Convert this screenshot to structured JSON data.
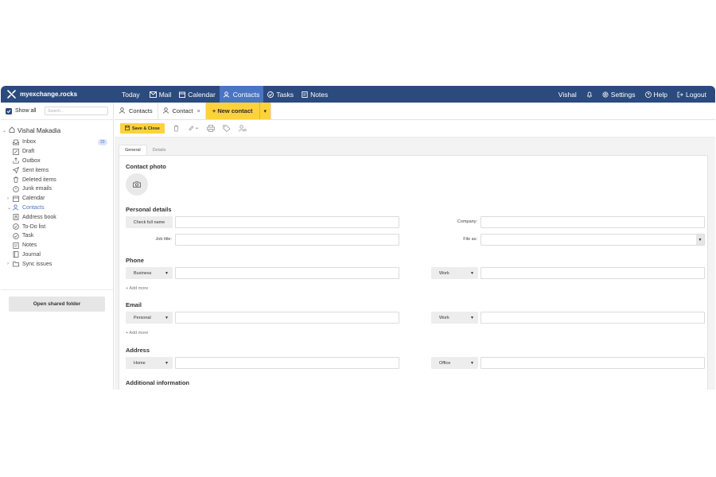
{
  "brand": {
    "name": "myexchange.rocks"
  },
  "nav": {
    "items": [
      {
        "label": "Today",
        "icon": "none"
      },
      {
        "label": "Mail",
        "icon": "mail-icon"
      },
      {
        "label": "Calendar",
        "icon": "calendar-icon"
      },
      {
        "label": "Contacts",
        "icon": "contacts-icon",
        "active": true
      },
      {
        "label": "Tasks",
        "icon": "tasks-icon"
      },
      {
        "label": "Notes",
        "icon": "notes-icon"
      }
    ],
    "user": "Vishal",
    "settings": "Settings",
    "help": "Help",
    "logout": "Logout"
  },
  "colors": {
    "topbar": "#2b4a7e",
    "active_nav": "#4a74c4",
    "accent_yellow": "#ffd23c"
  },
  "sidebar": {
    "show_all": "Show all",
    "search_placeholder": "Search...",
    "account": "Vishal Makadia",
    "items": [
      {
        "label": "Inbox",
        "icon": "inbox-icon",
        "badge": "20"
      },
      {
        "label": "Draft",
        "icon": "draft-icon"
      },
      {
        "label": "Outbox",
        "icon": "outbox-icon"
      },
      {
        "label": "Sent items",
        "icon": "send-icon"
      },
      {
        "label": "Deleted items",
        "icon": "trash-icon"
      },
      {
        "label": "Junk emails",
        "icon": "junk-icon"
      },
      {
        "label": "Calendar",
        "icon": "calendar-icon",
        "caret": "›"
      },
      {
        "label": "Contacts",
        "icon": "contacts-icon",
        "caret": "⌄",
        "active": true
      },
      {
        "label": "Address book",
        "icon": "address-book-icon"
      },
      {
        "label": "To-Do list",
        "icon": "todo-icon"
      },
      {
        "label": "Task",
        "icon": "task-icon"
      },
      {
        "label": "Notes",
        "icon": "notes-icon"
      },
      {
        "label": "Journal",
        "icon": "journal-icon"
      },
      {
        "label": "Sync issues",
        "icon": "folder-icon",
        "caret": "›"
      }
    ],
    "open_shared": "Open shared folder"
  },
  "tabs": {
    "contacts": "Contacts",
    "contact": "Contact",
    "close": "×",
    "new_contact": "+ New contact",
    "dropdown": "▾"
  },
  "toolbar": {
    "save_close": "Save & Close"
  },
  "form": {
    "tabs": [
      "General",
      "Details"
    ],
    "contact_photo": "Contact photo",
    "personal_details": "Personal details",
    "check_full_name": "Check full name",
    "company_label": "Company:",
    "job_title_label": "Job title:",
    "file_as_label": "File as:",
    "phone": "Phone",
    "phone_type_1": "Business",
    "phone_type_2": "Work",
    "add_more": "+ Add more",
    "email": "Email",
    "email_type_1": "Personal",
    "email_type_2": "Work",
    "address": "Address",
    "address_type_1": "Home",
    "address_type_2": "Office",
    "additional": "Additional information"
  }
}
